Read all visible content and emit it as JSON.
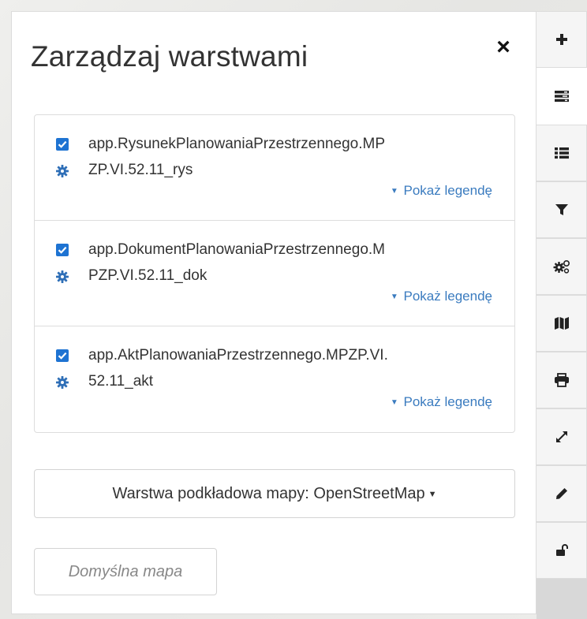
{
  "panel": {
    "title": "Zarządzaj warstwami",
    "close_label": "×"
  },
  "layers": [
    {
      "name": "app.RysunekPlanowaniaPrzestrzennego.MPZP.VI.52.11_rys",
      "checked": true,
      "legend_label": "Pokaż legendę"
    },
    {
      "name": "app.DokumentPlanowaniaPrzestrzennego.MPZP.VI.52.11_dok",
      "checked": true,
      "legend_label": "Pokaż legendę"
    },
    {
      "name": "app.AktPlanowaniaPrzestrzennego.MPZP.VI.52.11_akt",
      "checked": true,
      "legend_label": "Pokaż legendę"
    }
  ],
  "basemap": {
    "label": "Warstwa podkładowa mapy: OpenStreetMap"
  },
  "default_map": {
    "label": "Domyślna mapa"
  },
  "toolbar": {
    "items": [
      {
        "icon": "plus-icon"
      },
      {
        "icon": "layers-icon",
        "active": true
      },
      {
        "icon": "list-icon"
      },
      {
        "icon": "filter-icon"
      },
      {
        "icon": "gears-icon"
      },
      {
        "icon": "map-icon"
      },
      {
        "icon": "print-icon"
      },
      {
        "icon": "expand-icon"
      },
      {
        "icon": "pencil-icon"
      },
      {
        "icon": "unlock-icon"
      }
    ]
  },
  "colors": {
    "checkbox": "#1e73d2",
    "link": "#3a7bbf",
    "gear": "#2f6fb7"
  }
}
